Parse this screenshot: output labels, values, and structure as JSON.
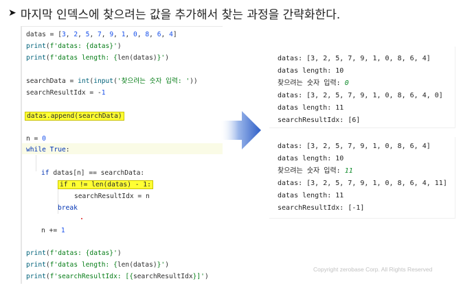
{
  "title": "마지막 인덱스에 찾으려는 값을 추가해서 찾는 과정을 간략화한다.",
  "code": [
    "datas = [3, 2, 5, 7, 9, 1, 0, 8, 6, 4]",
    "print(f'datas: {datas}')",
    "print(f'datas length: {len(datas)}')",
    "searchData = int(input('찾으려는 숫자 입력: '))",
    "searchResultIdx = -1",
    "datas.append(searchData)",
    "n = 0",
    "while True:",
    "if datas[n] == searchData:",
    "if n != len(datas) - 1:",
    "searchResultIdx = n",
    "break",
    "n += 1",
    "print(f'datas: {datas}')",
    "print(f'datas length: {len(datas)}')",
    "print(f'searchResultIdx: [{searchResultIdx}]')"
  ],
  "output_runs": [
    {
      "lines": [
        "datas: [3, 2, 5, 7, 9, 1, 0, 8, 6, 4]",
        "datas length: 10",
        "찾으려는 숫자 입력: ",
        "datas: [3, 2, 5, 7, 9, 1, 0, 8, 6, 4, 0]",
        "datas length: 11",
        "searchResultIdx: [6]"
      ],
      "input_value": "0"
    },
    {
      "lines": [
        "datas: [3, 2, 5, 7, 9, 1, 0, 8, 6, 4]",
        "datas length: 10",
        "찾으려는 숫자 입력: ",
        "datas: [3, 2, 5, 7, 9, 1, 0, 8, 6, 4, 11]",
        "datas length: 11",
        "searchResultIdx: [-1]"
      ],
      "input_value": "11"
    }
  ],
  "copyright": "Copyright zerobase Corp. All Rights Reserved",
  "colors": {
    "highlight": "#ffff33",
    "arrow": "#2f5fc7",
    "keyword": "#0033b3",
    "string": "#067d17"
  }
}
